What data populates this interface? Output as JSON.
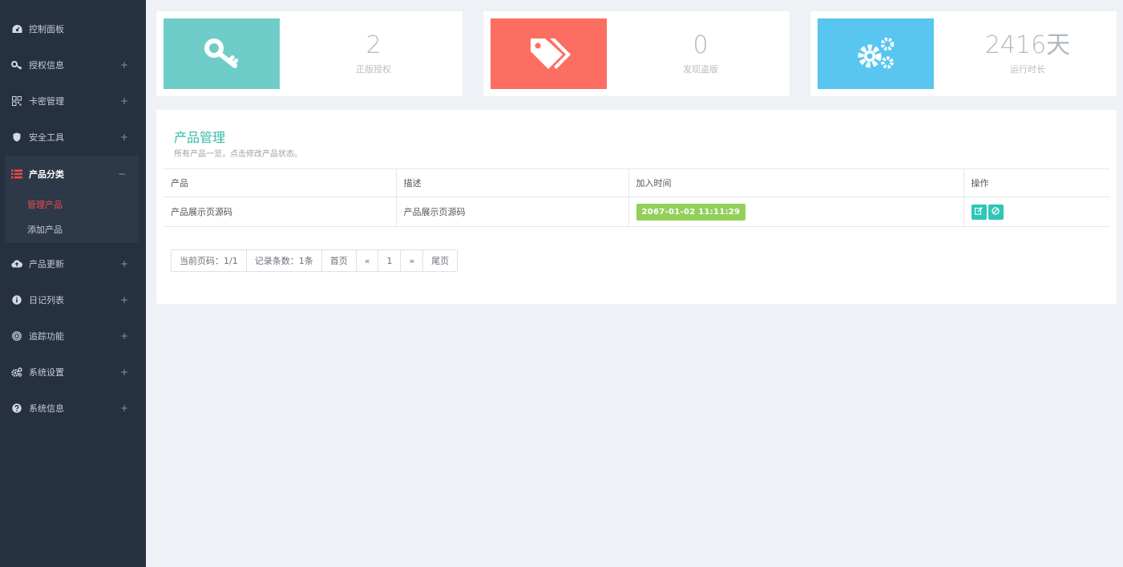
{
  "sidebar": {
    "items": [
      {
        "label": "控制面板",
        "icon": "dashboard-icon"
      },
      {
        "label": "授权信息",
        "icon": "key-icon",
        "toggle": "+"
      },
      {
        "label": "卡密管理",
        "icon": "qrcode-icon",
        "toggle": "+"
      },
      {
        "label": "安全工具",
        "icon": "shield-icon",
        "toggle": "+"
      },
      {
        "label": "产品分类",
        "icon": "list-icon",
        "toggle": "−"
      },
      {
        "label": "产品更新",
        "icon": "cloud-upload-icon",
        "toggle": "+"
      },
      {
        "label": "日记列表",
        "icon": "info-icon",
        "toggle": "+"
      },
      {
        "label": "追踪功能",
        "icon": "target-icon",
        "toggle": "+"
      },
      {
        "label": "系统设置",
        "icon": "gears-icon",
        "toggle": "+"
      },
      {
        "label": "系统信息",
        "icon": "question-icon",
        "toggle": "+"
      }
    ],
    "submenu": [
      {
        "label": "管理产品"
      },
      {
        "label": "添加产品"
      }
    ]
  },
  "stats": [
    {
      "value": "2",
      "caption": "正版授权",
      "color": "#6ecdc8",
      "icon": "key-icon"
    },
    {
      "value": "0",
      "caption": "发现盗版",
      "color": "#fd6e62",
      "icon": "tags-icon"
    },
    {
      "value": "2416天",
      "caption": "运行时长",
      "color": "#58c6f0",
      "icon": "gears-icon"
    }
  ],
  "panel": {
    "title": "产品管理",
    "subtitle": "所有产品一览，点击修改产品状态。",
    "columns": [
      "产品",
      "描述",
      "加入时间",
      "操作"
    ],
    "rows": [
      {
        "product": "产品展示页源码",
        "description": "产品展示页源码",
        "joined": "2067-01-02 11:11:29",
        "actions": [
          "edit-icon",
          "disable-icon"
        ]
      }
    ],
    "pagination": {
      "current": "当前页码：1/1",
      "records": "记录条数：1条",
      "first": "首页",
      "prev": "«",
      "page": "1",
      "next": "»",
      "last": "尾页"
    }
  },
  "colors": {
    "sidebar_bg": "#253040",
    "accent": "#36b8a8",
    "active": "#f24a4a",
    "badge": "#92d05a"
  }
}
